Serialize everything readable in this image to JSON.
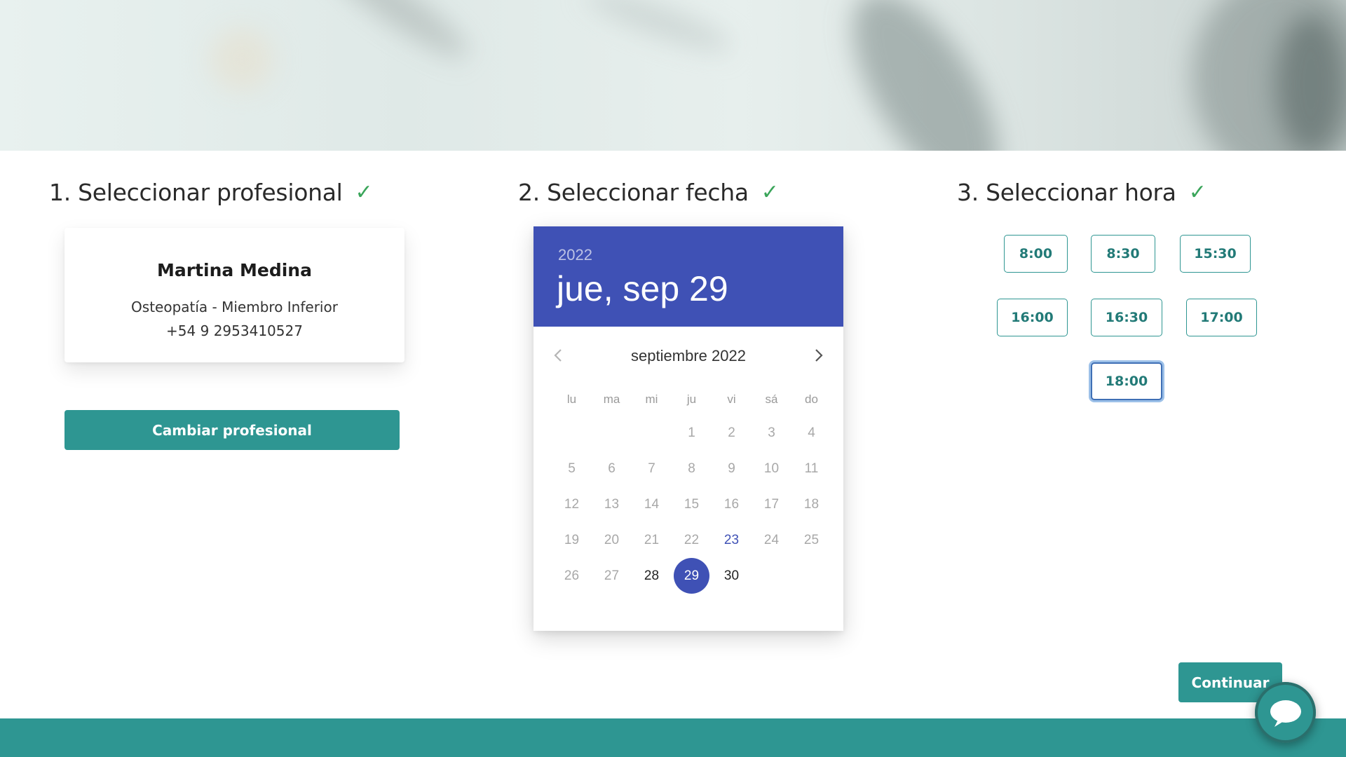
{
  "steps": {
    "professional": {
      "title": "1. Seleccionar profesional",
      "done": true
    },
    "date": {
      "title": "2. Seleccionar fecha",
      "done": true
    },
    "time": {
      "title": "3. Seleccionar hora",
      "done": true
    }
  },
  "professional": {
    "name": "Martina Medina",
    "specialty": "Osteopatía - Miembro Inferior",
    "phone": "+54 9 2953410527",
    "change_label": "Cambiar profesional"
  },
  "calendar": {
    "year": "2022",
    "selected_date_label": "jue, sep 29",
    "month_label": "septiembre 2022",
    "weekdays": [
      "lu",
      "ma",
      "mi",
      "ju",
      "vi",
      "sá",
      "do"
    ],
    "weeks": [
      [
        "",
        "",
        "",
        "1",
        "2",
        "3",
        "4"
      ],
      [
        "5",
        "6",
        "7",
        "8",
        "9",
        "10",
        "11"
      ],
      [
        "12",
        "13",
        "14",
        "15",
        "16",
        "17",
        "18"
      ],
      [
        "19",
        "20",
        "21",
        "22",
        "23",
        "24",
        "25"
      ],
      [
        "26",
        "27",
        "28",
        "29",
        "30",
        "",
        ""
      ]
    ],
    "today": "23",
    "selected": "29",
    "available_days": [
      "28",
      "29",
      "30"
    ]
  },
  "time_slots": {
    "rows": [
      [
        "8:00",
        "8:30",
        "15:30"
      ],
      [
        "16:00",
        "16:30",
        "17:00"
      ],
      [
        "18:00"
      ]
    ],
    "selected": "18:00"
  },
  "actions": {
    "continue_label": "Continuar"
  },
  "icons": {
    "step_done": "check-icon",
    "prev_month": "chevron-left-icon",
    "next_month": "chevron-right-icon",
    "chat": "chat-bubble-icon"
  },
  "colors": {
    "teal": "#2e9692",
    "calendar_header": "#3f51b5",
    "check": "#3aa55a"
  }
}
